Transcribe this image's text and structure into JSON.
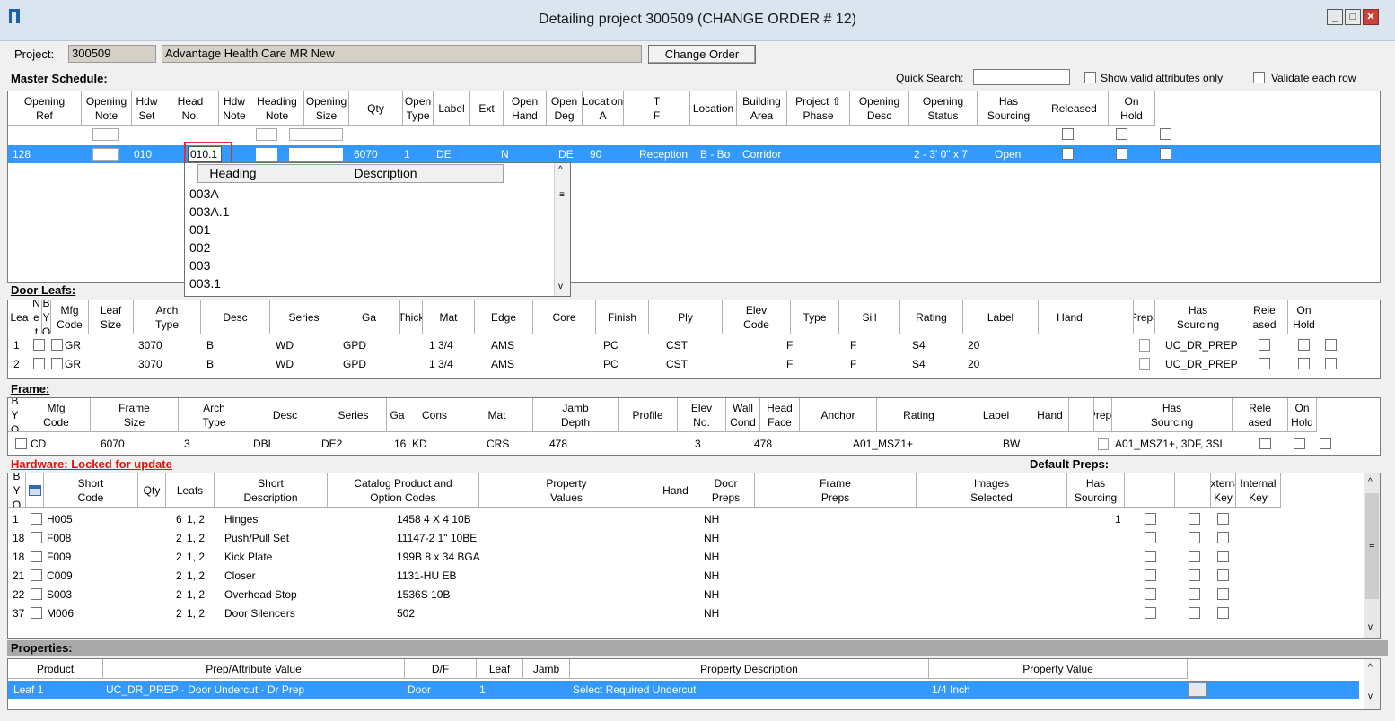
{
  "window": {
    "title": "Detailing project 300509   (CHANGE ORDER # 12)",
    "min": "‒",
    "max": "▢",
    "close": "✕"
  },
  "project": {
    "label": "Project:",
    "number": "300509",
    "name": "Advantage Health Care MR New",
    "change_order_btn": "Change Order"
  },
  "master": {
    "title": "Master Schedule:",
    "quick_search_label": "Quick Search:",
    "quick_search_value": "",
    "show_valid": "Show valid attributes only",
    "validate": "Validate each row",
    "headers": [
      "Opening\nRef",
      "Opening\nNote",
      "Hdw\nSet",
      "Head\nNo.",
      "Hdw\nNote",
      "Heading\nNote",
      "Opening\nSize",
      "Qty",
      "Open\nType",
      "Label",
      "Ext",
      "Open\nHand",
      "Open\nDeg",
      "Location A",
      "T\nF",
      "Location",
      "Building\nArea",
      "Project ⇧\nPhase",
      "Opening\nDesc",
      "Opening\nStatus",
      "Has\nSourcing",
      "Released",
      "On\nHold"
    ],
    "row": {
      "ref": "128",
      "hdw_set": "010",
      "head_no": "010.1",
      "size": "6070",
      "qty": "1",
      "type": "DE",
      "ext": "N",
      "hand": "DE",
      "deg": "90",
      "loc_a": "Reception",
      "tf": "B - Bo",
      "location": "Corridor",
      "desc": "2 - 3' 0\" x 7",
      "status": "Open"
    },
    "dropdown": {
      "col1": "Heading",
      "col2": "Description",
      "items": [
        "003A",
        "003A.1",
        "001",
        "002",
        "003",
        "003.1"
      ]
    }
  },
  "door": {
    "title": "Door Leafs:",
    "headers": [
      "Lea",
      "N\ne\nt",
      "B\nY\nO",
      "Mfg\nCode",
      "Leaf\nSize",
      "Arch\nType",
      "Desc",
      "Series",
      "Ga",
      "Thick",
      "Mat",
      "Edge",
      "Core",
      "Finish",
      "Ply",
      "Elev\nCode",
      "Type",
      "Sill",
      "Rating",
      "Label",
      "Hand",
      "",
      "Preps",
      "Has\nSourcing",
      "Rele\nased",
      "On\nHold"
    ],
    "rows": [
      {
        "n": "1",
        "mfg": "GR",
        "size": "3070",
        "arch": "B",
        "desc": "WD",
        "series": "GPD",
        "thick": "1 3/4",
        "mat": "AMS",
        "core": "PC",
        "finish": "CST",
        "ply": "F",
        "type": "F",
        "sill": "S4",
        "rating": "20",
        "preps": "UC_DR_PREP"
      },
      {
        "n": "2",
        "mfg": "GR",
        "size": "3070",
        "arch": "B",
        "desc": "WD",
        "series": "GPD",
        "thick": "1 3/4",
        "mat": "AMS",
        "core": "PC",
        "finish": "CST",
        "ply": "F",
        "type": "F",
        "sill": "S4",
        "rating": "20",
        "preps": "UC_DR_PREP"
      }
    ]
  },
  "frame": {
    "title": "Frame:",
    "headers": [
      "B\nY\nO",
      "Mfg\nCode",
      "Frame\nSize",
      "Arch\nType",
      "Desc",
      "Series",
      "Ga",
      "Cons",
      "Mat",
      "Jamb\nDepth",
      "Profile",
      "Elev\nNo.",
      "Wall\nCond",
      "Head\nFace",
      "Anchor",
      "Rating",
      "Label",
      "Hand",
      "",
      "Preps",
      "Has\nSourcing",
      "Rele\nased",
      "On\nHold"
    ],
    "row": {
      "mfg": "CD",
      "size": "6070",
      "arch": "3",
      "desc": "DBL",
      "series": "DE2",
      "ga": "16",
      "cons": "KD",
      "mat": "CRS",
      "jamb": "478",
      "elev": "3",
      "wall": "478",
      "anchor": "A01_MSZ1+",
      "label": "BW",
      "preps": "A01_MSZ1+, 3DF, 3SI"
    }
  },
  "hardware": {
    "title": "Hardware: Locked for update",
    "default_preps": "Default Preps:",
    "headers": [
      "B\nY\nO",
      "",
      "Short\nCode",
      "Qty",
      "Leafs",
      "Short\nDescription",
      "Catalog Product and\nOption Codes",
      "Property\nValues",
      "Hand",
      "Door\nPreps",
      "Frame\nPreps",
      "Images\nSelected",
      "Has\nSourcing",
      "",
      "",
      "External\nKey",
      "Internal\nKey"
    ],
    "rows": [
      {
        "n": "1",
        "code": "H005",
        "qty": "6",
        "leafs": "1, 2",
        "desc": "Hinges",
        "cat": "1458 4 X 4 10B",
        "hand": "NH",
        "img": "1"
      },
      {
        "n": "18",
        "code": "F008",
        "qty": "2",
        "leafs": "1, 2",
        "desc": "Push/Pull Set",
        "cat": "11147-2 1\" 10BE",
        "hand": "NH",
        "img": ""
      },
      {
        "n": "18",
        "code": "F009",
        "qty": "2",
        "leafs": "1, 2",
        "desc": "Kick Plate",
        "cat": "199B 8 x 34 BGA",
        "hand": "NH",
        "img": ""
      },
      {
        "n": "21",
        "code": "C009",
        "qty": "2",
        "leafs": "1, 2",
        "desc": "Closer",
        "cat": "1131-HU EB",
        "hand": "NH",
        "img": ""
      },
      {
        "n": "22",
        "code": "S003",
        "qty": "2",
        "leafs": "1, 2",
        "desc": "Overhead Stop",
        "cat": "1536S 10B",
        "hand": "NH",
        "img": ""
      },
      {
        "n": "37",
        "code": "M006",
        "qty": "2",
        "leafs": "1, 2",
        "desc": "Door Silencers",
        "cat": "502",
        "hand": "NH",
        "img": ""
      }
    ]
  },
  "properties": {
    "title": "Properties:",
    "headers": [
      "Product",
      "Prep/Attribute Value",
      "D/F",
      "Leaf",
      "Jamb",
      "Property Description",
      "Property Value"
    ],
    "row": {
      "product": "Leaf 1",
      "prep": "UC_DR_PREP - Door Undercut - Dr Prep",
      "df": "Door",
      "leaf": "1",
      "jamb": "",
      "desc": "Select Required Undercut",
      "value": "1/4 Inch"
    }
  },
  "icons": {
    "app": "app-logo-icon",
    "scroll_up": "▲",
    "scroll_down": "▼"
  }
}
